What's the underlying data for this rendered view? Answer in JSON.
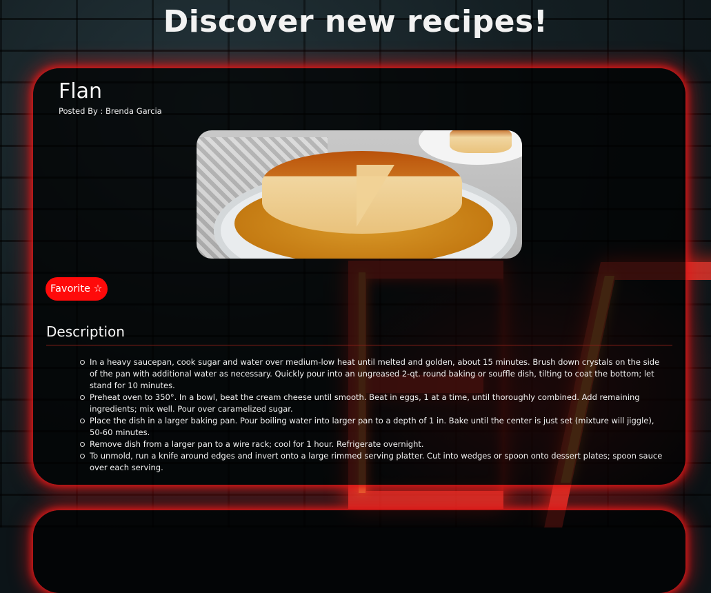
{
  "page": {
    "title": "Discover new recipes!"
  },
  "recipe": {
    "name": "Flan",
    "posted_by": "Posted By : Brenda Garcia",
    "favorite_label": "Favorite ☆",
    "description_heading": "Description",
    "steps": [
      "In a heavy saucepan, cook sugar and water over medium-low heat until melted and golden, about 15 minutes. Brush down crystals on the side of the pan with additional water as necessary. Quickly pour into an ungreased 2-qt. round baking or souffle dish, tilting to coat the bottom; let stand for 10 minutes.",
      "Preheat oven to 350°. In a bowl, beat the cream cheese until smooth. Beat in eggs, 1 at a time, until thoroughly combined. Add remaining ingredients; mix well. Pour over caramelized sugar.",
      "Place the dish in a larger baking pan. Pour boiling water into larger pan to a depth of 1 in. Bake until the center is just set (mixture will jiggle), 50-60 minutes.",
      "Remove dish from a larger pan to a wire rack; cool for 1 hour. Refrigerate overnight.",
      "To unmold, run a knife around edges and invert onto a large rimmed serving platter. Cut into wedges or spoon onto dessert plates; spoon sauce over each serving."
    ]
  },
  "colors": {
    "accent": "#ff0a0a",
    "card_glow": "#d81818",
    "background": "#0c1418"
  }
}
